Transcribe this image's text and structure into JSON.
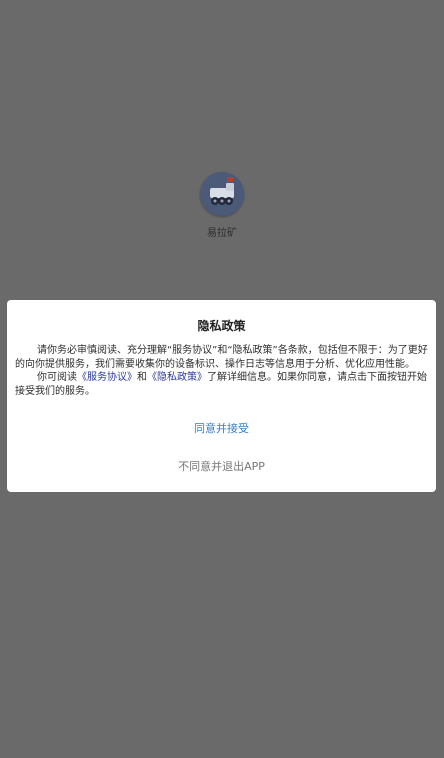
{
  "app": {
    "label": "易拉矿",
    "icon": "mining-truck-icon"
  },
  "privacy_dialog": {
    "title": "隐私政策",
    "body_part1": "请你务必审慎阅读、充分理解“服务协议”和“隐私政策”各条款，包括但不限于：为了更好的向你提供服务，我们需要收集你的设备标识、操作日志等信息用于分析、优化应用性能。",
    "body_part2_prefix": "你可阅读",
    "service_agreement_link": "《服务协议》",
    "and": "和",
    "privacy_policy_link": "《隐私政策》",
    "body_part2_suffix": "了解详细信息。如果你同意，请点击下面按钮开始接受我们的服务。",
    "agree_label": "同意并接受",
    "reject_label": "不同意并退出APP"
  },
  "colors": {
    "overlay": "#6a6a6a",
    "agree": "#3a7fc0",
    "link": "#2b3a9c"
  },
  "icons": {
    "back": "chevron-left-icon"
  }
}
